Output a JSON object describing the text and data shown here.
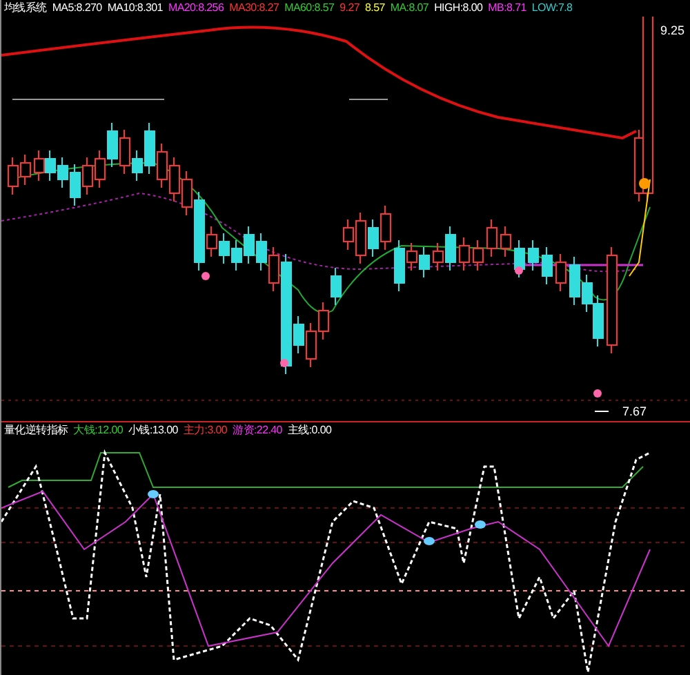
{
  "top_panel": {
    "header": [
      {
        "text": "均线系统",
        "color": "#ffffff"
      },
      {
        "text": "MA5:8.270",
        "color": "#ffffff"
      },
      {
        "text": "MA10:8.301",
        "color": "#ffffff"
      },
      {
        "text": "MA20:8.256",
        "color": "#ff33ff"
      },
      {
        "text": "MA30:8.27",
        "color": "#ff3333"
      },
      {
        "text": "MA60:8.57",
        "color": "#33cc33"
      },
      {
        "text": "9.27",
        "color": "#ff3333"
      },
      {
        "text": "8.57",
        "color": "#ffff33"
      },
      {
        "text": "MA:8.07",
        "color": "#33cc33"
      },
      {
        "text": "HIGH:8.00",
        "color": "#ffffff"
      },
      {
        "text": "MB:8.71",
        "color": "#ff33ff"
      },
      {
        "text": "LOW:7.8",
        "color": "#33cccc"
      }
    ],
    "high_label": "9.25",
    "low_label": "7.67"
  },
  "bottom_panel": {
    "header": [
      {
        "text": "量化逆转指标",
        "color": "#ffffff"
      },
      {
        "text": "大钱:12.00",
        "color": "#33cc33"
      },
      {
        "text": "小钱:13.00",
        "color": "#ffffff"
      },
      {
        "text": "主力:3.00",
        "color": "#ff3333"
      },
      {
        "text": "游资:22.40",
        "color": "#ff33ff"
      },
      {
        "text": "主线:0.00",
        "color": "#ffffff"
      }
    ]
  }
}
